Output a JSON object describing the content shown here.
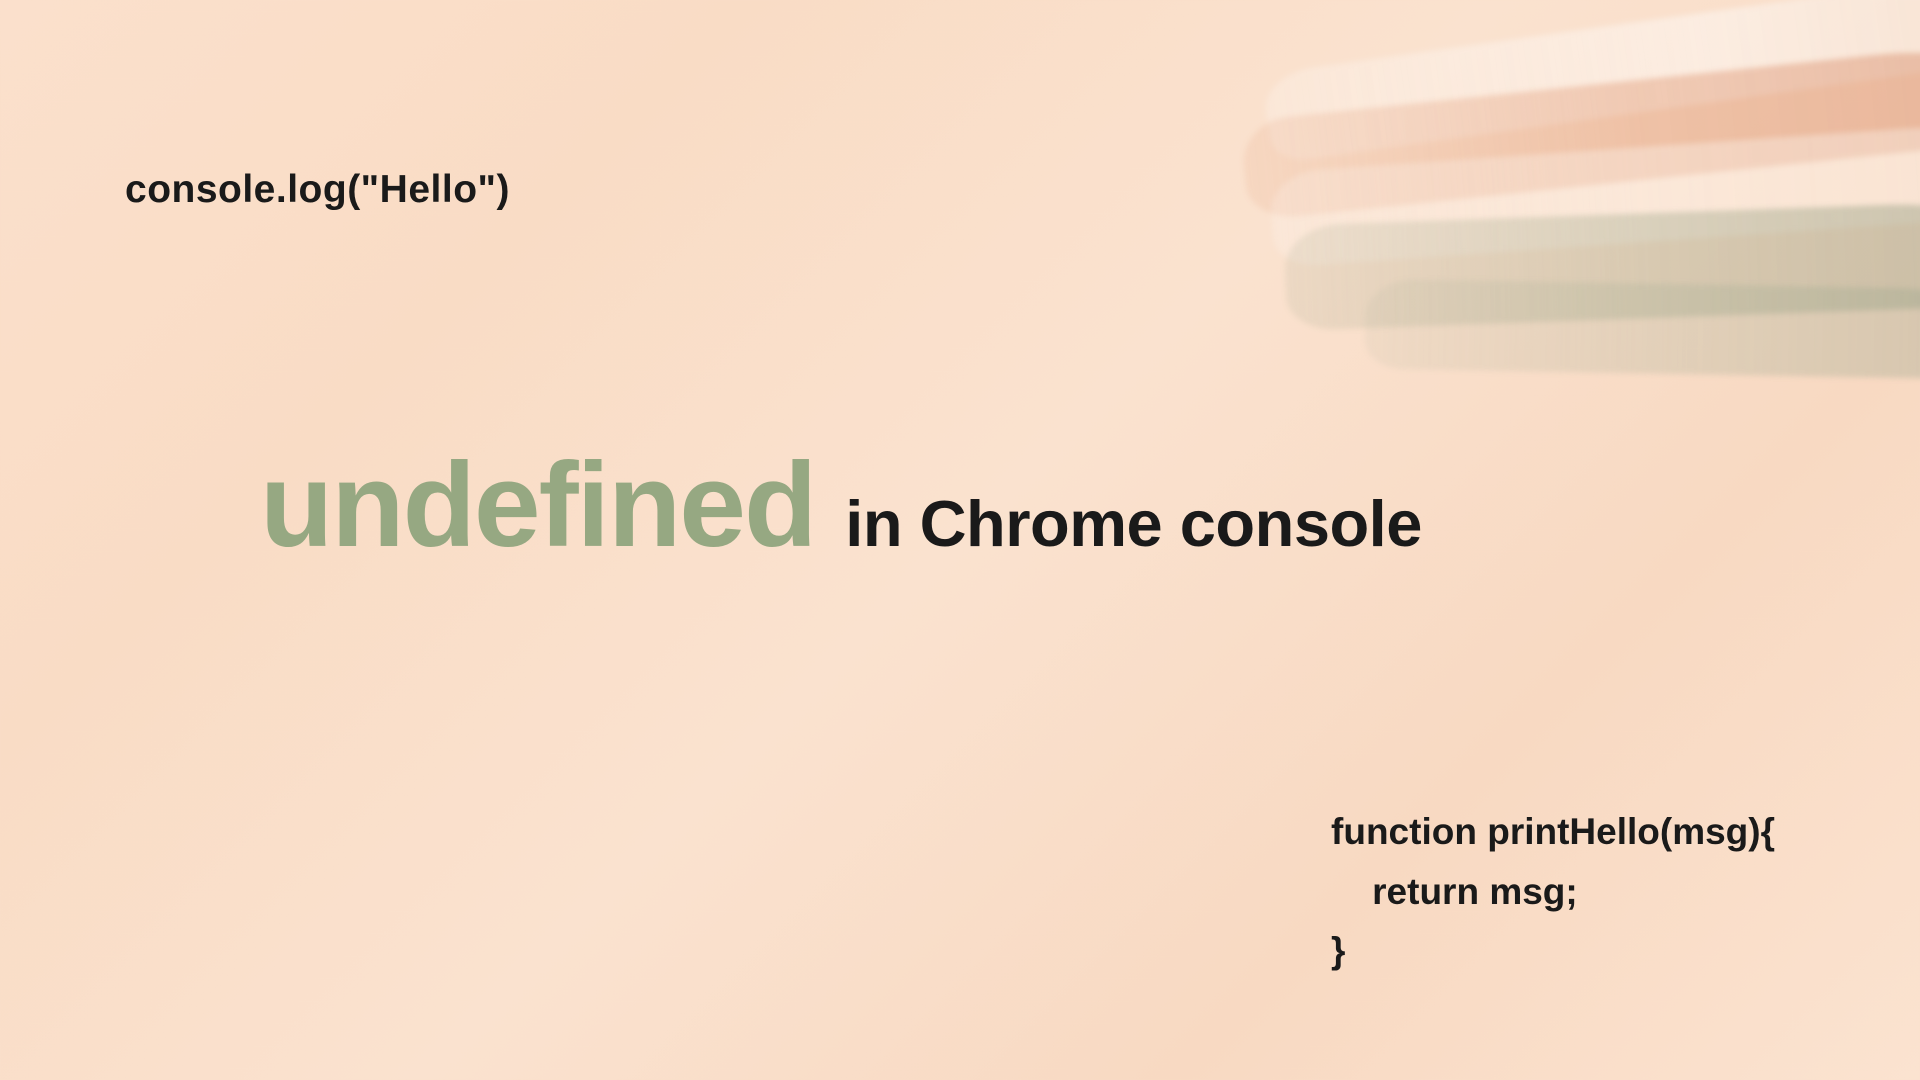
{
  "snippets": {
    "top": "console.log(\"Hello\")",
    "bottom": "function printHello(msg){\n    return msg;\n}"
  },
  "title": {
    "highlighted": "undefined",
    "rest": "in Chrome console"
  },
  "colors": {
    "background": "#fbe0cc",
    "highlight": "#96a882",
    "text": "#1a1a1a"
  }
}
